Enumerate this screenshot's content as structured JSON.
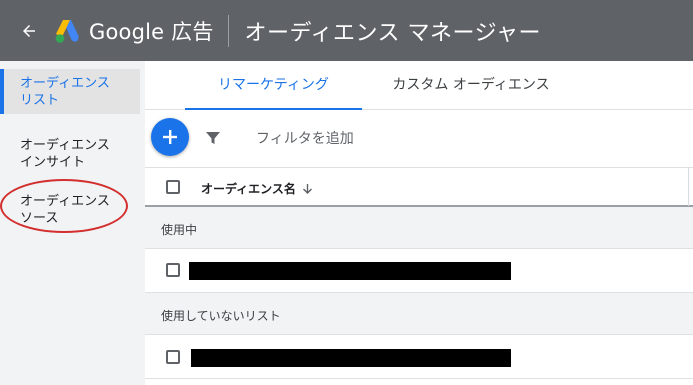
{
  "header": {
    "back_icon": "arrow-back-icon",
    "brand": "Google 広告",
    "title": "オーディエンス マネージャー",
    "colors": {
      "bar": "#5f6368",
      "logo_blue": "#4285f4",
      "logo_yellow": "#fbbc04",
      "logo_green": "#34a853"
    }
  },
  "sidebar": {
    "items": [
      {
        "line1": "オーディエンス",
        "line2": "リスト",
        "active": true
      },
      {
        "line1": "オーディエンス",
        "line2": "インサイト",
        "active": false
      },
      {
        "line1": "オーディエンス",
        "line2": "ソース",
        "active": false
      }
    ],
    "highlight_color": "#d32f2f"
  },
  "tabs": [
    {
      "label": "リマーケティング",
      "active": true
    },
    {
      "label": "カスタム オーディエンス",
      "active": false
    }
  ],
  "toolbar": {
    "add_icon": "plus-icon",
    "filter_icon": "filter-icon",
    "filter_label": "フィルタを追加"
  },
  "table": {
    "column_header": "オーディエンス名",
    "sort_icon": "arrow-down-icon",
    "groups": [
      {
        "label": "使用中",
        "rows": [
          {
            "name": ""
          }
        ]
      },
      {
        "label": "使用していないリスト",
        "rows": [
          {
            "name": ""
          }
        ]
      }
    ]
  },
  "accent_color": "#1a73e8"
}
